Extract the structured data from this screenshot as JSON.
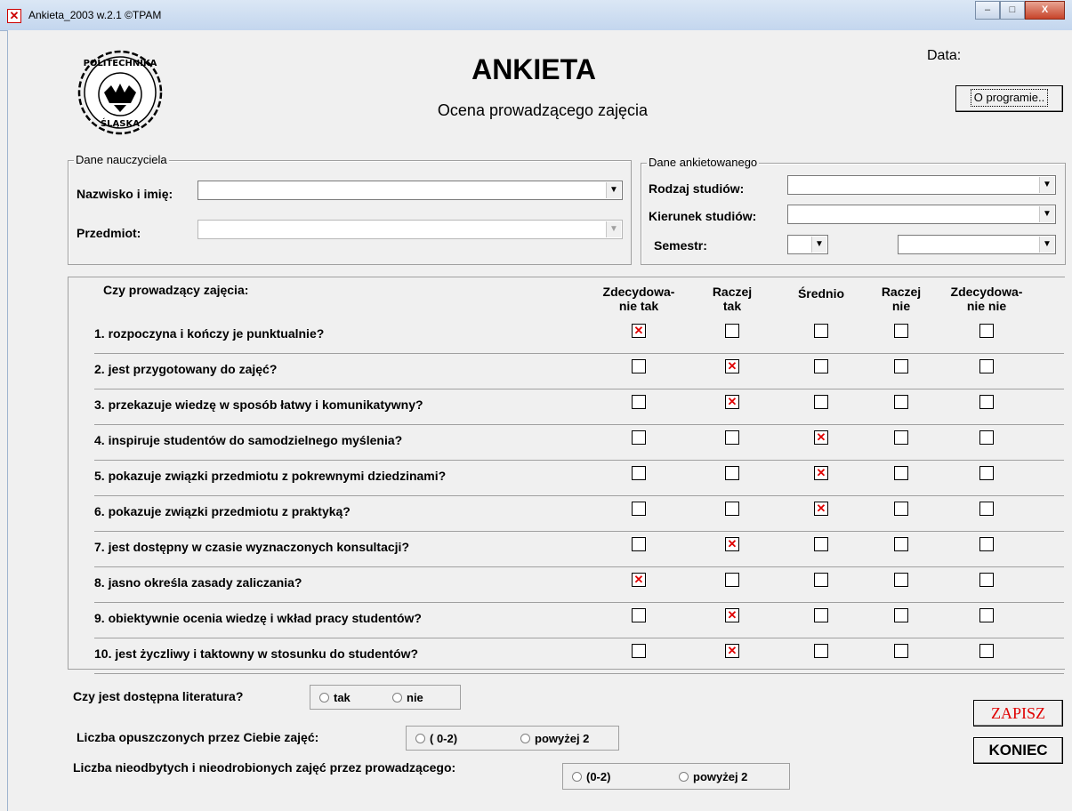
{
  "window": {
    "title": "Ankieta_2003   w.2.1  ©TPAM",
    "minimize": "–",
    "maximize": "□",
    "close": "X"
  },
  "header": {
    "title": "ANKIETA",
    "subtitle": "Ocena prowadzącego zajęcia",
    "date_label": "Data:",
    "about_button": "O programie..",
    "logo_text_top": "POLITECHNIKA",
    "logo_text_bottom": "ŚLĄSKA"
  },
  "teacher": {
    "group_label": "Dane nauczyciela",
    "name_label": "Nazwisko i imię:",
    "name_value": "",
    "subject_label": "Przedmiot:",
    "subject_value": ""
  },
  "respondent": {
    "group_label": "Dane ankietowanego",
    "study_type_label": "Rodzaj studiów:",
    "study_type_value": "",
    "field_label": "Kierunek studiów:",
    "field_value": "",
    "semester_label": "Semestr:",
    "semester_value": "",
    "semester_extra_value": ""
  },
  "survey": {
    "question_header": "Czy prowadzący zajęcia:",
    "columns": [
      "Zdecydowa-\nnie tak",
      "Raczej\ntak",
      "Średnio",
      "Raczej\nnie",
      "Zdecydowa-\nnie nie"
    ],
    "questions": [
      {
        "text": "1. rozpoczyna i kończy je punktualnie?",
        "selected": 0
      },
      {
        "text": "2. jest przygotowany do zajęć?",
        "selected": 1
      },
      {
        "text": "3. przekazuje wiedzę w sposób łatwy i komunikatywny?",
        "selected": 1
      },
      {
        "text": "4. inspiruje studentów do samodzielnego myślenia?",
        "selected": 2
      },
      {
        "text": "5. pokazuje związki przedmiotu z pokrewnymi dziedzinami?",
        "selected": 2
      },
      {
        "text": "6. pokazuje związki przedmiotu z praktyką?",
        "selected": 2
      },
      {
        "text": "7. jest dostępny w czasie wyznaczonych konsultacji?",
        "selected": 1
      },
      {
        "text": "8. jasno określa zasady zaliczania?",
        "selected": 0
      },
      {
        "text": "9. obiektywnie ocenia wiedzę i wkład pracy studentów?",
        "selected": 1
      },
      {
        "text": "10. jest życzliwy i taktowny w stosunku do studentów?",
        "selected": 1
      }
    ]
  },
  "extra": {
    "literature_label": "Czy jest dostępna literatura?",
    "literature_options": [
      "tak",
      "nie"
    ],
    "absences_label": "Liczba opuszczonych przez Ciebie zajęć:",
    "absences_options": [
      "( 0-2)",
      "powyżej 2"
    ],
    "cancelled_label": "Liczba nieodbytych i nieodrobionych zajęć przez prowadzącego:",
    "cancelled_options": [
      "(0-2)",
      "powyżej 2"
    ]
  },
  "actions": {
    "save": "ZAPISZ",
    "exit": "KONIEC"
  }
}
